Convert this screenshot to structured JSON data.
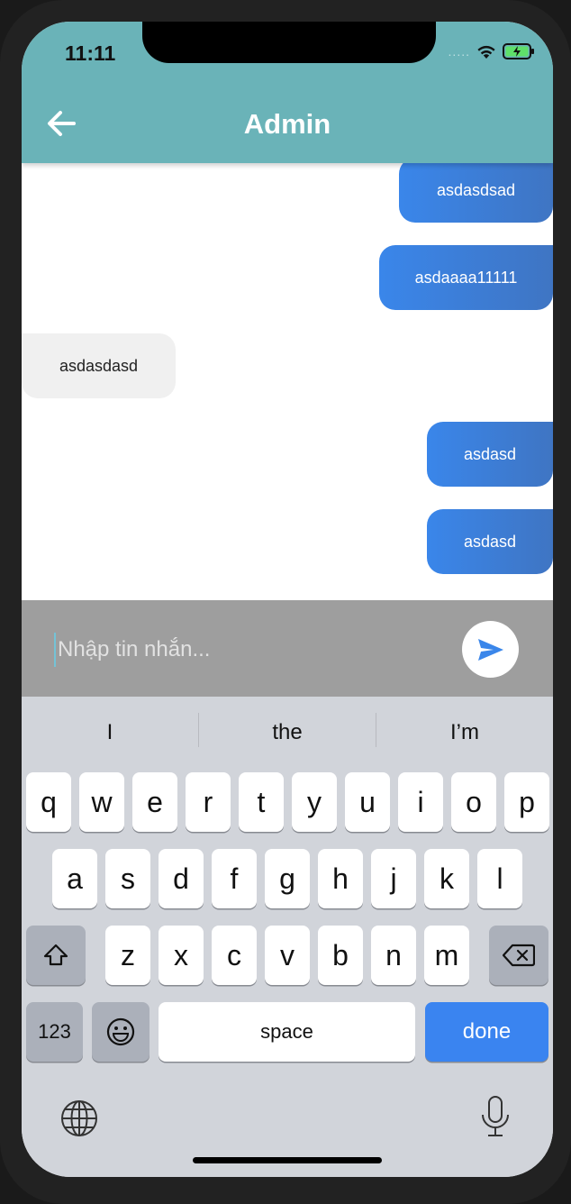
{
  "status": {
    "time": "11:11",
    "signal_dots": "....."
  },
  "appbar": {
    "title": "Admin"
  },
  "messages": [
    {
      "text": "asdasdsad",
      "side": "sent"
    },
    {
      "text": "asdaaaa11111",
      "side": "sent"
    },
    {
      "text": "asdasdasd",
      "side": "received"
    },
    {
      "text": "asdasd",
      "side": "sent"
    },
    {
      "text": "asdasd",
      "side": "sent"
    }
  ],
  "composer": {
    "placeholder": "Nhập tin nhắn...",
    "value": ""
  },
  "keyboard": {
    "suggestions": [
      "I",
      "the",
      "I’m"
    ],
    "row1": [
      "q",
      "w",
      "e",
      "r",
      "t",
      "y",
      "u",
      "i",
      "o",
      "p"
    ],
    "row2": [
      "a",
      "s",
      "d",
      "f",
      "g",
      "h",
      "j",
      "k",
      "l"
    ],
    "row3": [
      "z",
      "x",
      "c",
      "v",
      "b",
      "n",
      "m"
    ],
    "numbers_label": "123",
    "space_label": "space",
    "done_label": "done"
  },
  "colors": {
    "appbar": "#6ab3b8",
    "sent_bubble": "#3a86ea",
    "received_bubble": "#f0f0f0",
    "composer_bg": "#9e9e9e",
    "send_icon": "#3a86ea",
    "done_key": "#3a84f0"
  }
}
